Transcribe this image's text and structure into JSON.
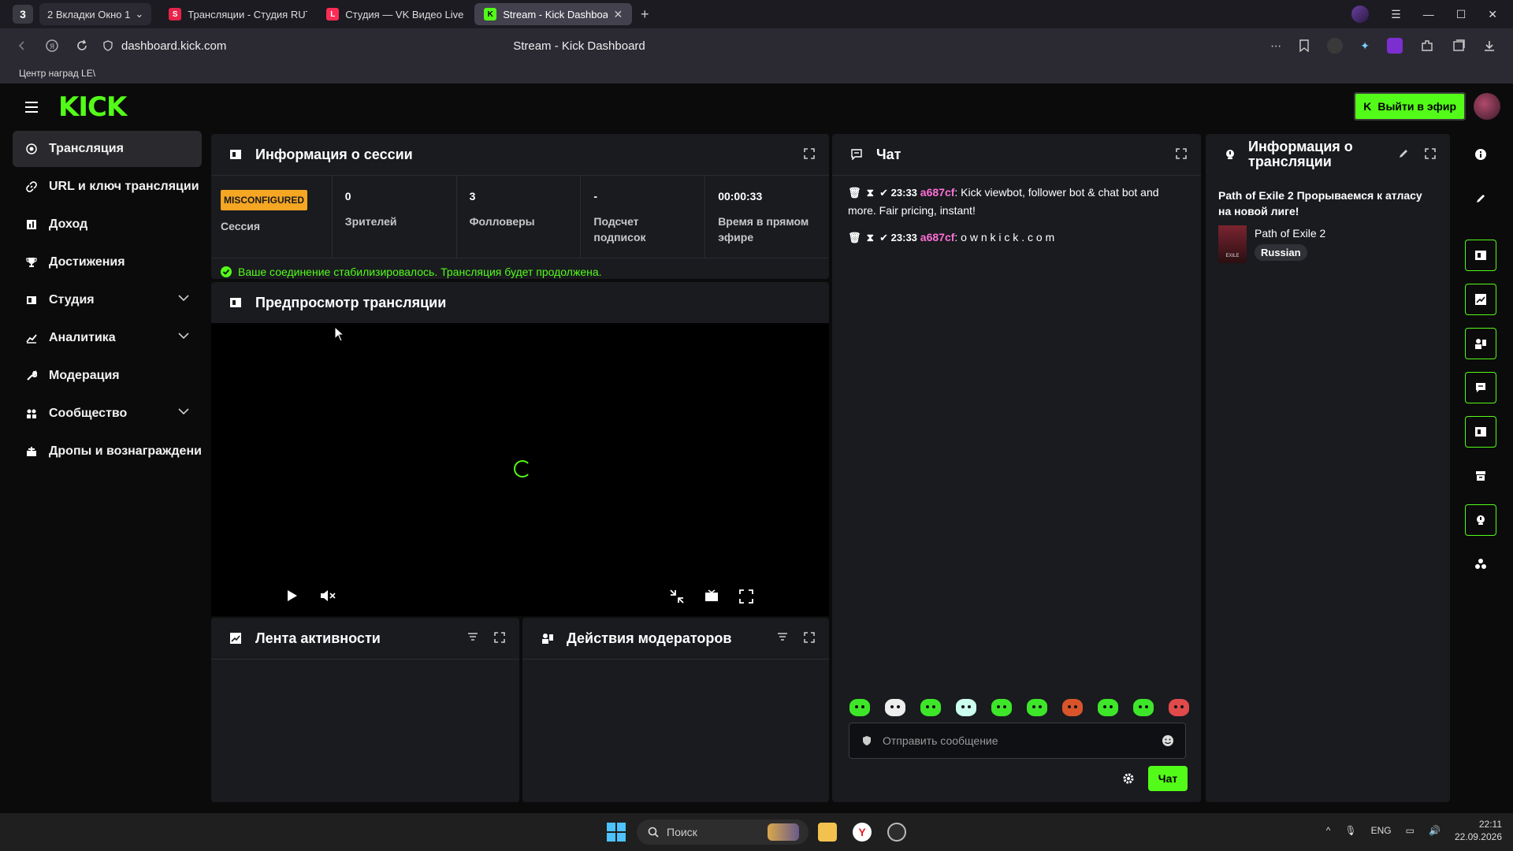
{
  "browser": {
    "tab_counter": "3",
    "tab_group_label": "2  Вкладки Окно 1",
    "tabs": [
      {
        "title": "Трансляции - Студия RUT",
        "fav_color": "#e8234a",
        "fav_letter": "S"
      },
      {
        "title": "Студия — VK Видео Live",
        "fav_color": "#ff2d55",
        "fav_letter": "L"
      },
      {
        "title": "Stream - Kick Dashboard",
        "fav_color": "#53fc18",
        "fav_letter": "K"
      }
    ],
    "url": "dashboard.kick.com",
    "page_title": "Stream - Kick Dashboard",
    "bookmark": "Центр наград LE\\"
  },
  "header": {
    "logo": "KICK",
    "go_live": "Выйти в эфир"
  },
  "sidebar": {
    "items": [
      {
        "label": "Трансляция",
        "icon": "broadcast-icon"
      },
      {
        "label": "URL и ключ трансляции",
        "icon": "link-icon"
      },
      {
        "label": "Доход",
        "icon": "revenue-icon"
      },
      {
        "label": "Достижения",
        "icon": "trophy-icon"
      },
      {
        "label": "Студия",
        "icon": "studio-icon"
      },
      {
        "label": "Аналитика",
        "icon": "analytics-icon"
      },
      {
        "label": "Модерация",
        "icon": "wrench-icon"
      },
      {
        "label": "Сообщество",
        "icon": "community-icon"
      },
      {
        "label": "Дропы и вознаграждения",
        "icon": "gift-icon"
      }
    ]
  },
  "session": {
    "title": "Информация о сессии",
    "badge": "MISCONFIGURED",
    "session_label": "Сессия",
    "viewers_value": "0",
    "viewers_label": "Зрителей",
    "followers_value": "3",
    "followers_label": "Фолловеры",
    "subs_value": "-",
    "subs_label": "Подсчет подписок",
    "uptime_value": "00:00:33",
    "uptime_label": "Время в прямом эфире",
    "connection_msg": "Ваше соединение стабилизировалось. Трансляция будет продолжена."
  },
  "preview": {
    "title": "Предпросмотр трансляции"
  },
  "activity": {
    "title": "Лента активности"
  },
  "mod_actions": {
    "title": "Действия модераторов"
  },
  "chat": {
    "title": "Чат",
    "messages": [
      {
        "time": "23:33",
        "user": "a687cf",
        "text": "Kick viewbot, follower bot & chat bot and more. Fair pricing, instant!"
      },
      {
        "time": "23:33",
        "user": "a687cf",
        "text": "o w n k i c k . c o m"
      }
    ],
    "input_placeholder": "Отправить сообщение",
    "send_label": "Чат"
  },
  "stream_info": {
    "title": "Информация о трансляции",
    "stream_title": "Path of Exile 2 Прорываемся к атласу на новой лиге!",
    "category": "Path of Exile 2",
    "language": "Russian",
    "thumb_text": "EXILE"
  },
  "taskbar": {
    "search": "Поиск",
    "lang": "ENG",
    "time": "22:11",
    "date": "22.09.2026"
  },
  "colors": {
    "accent": "#53fc18",
    "warning": "#f5a623",
    "username": "#ff6fd8",
    "panel": "#191b1f"
  }
}
